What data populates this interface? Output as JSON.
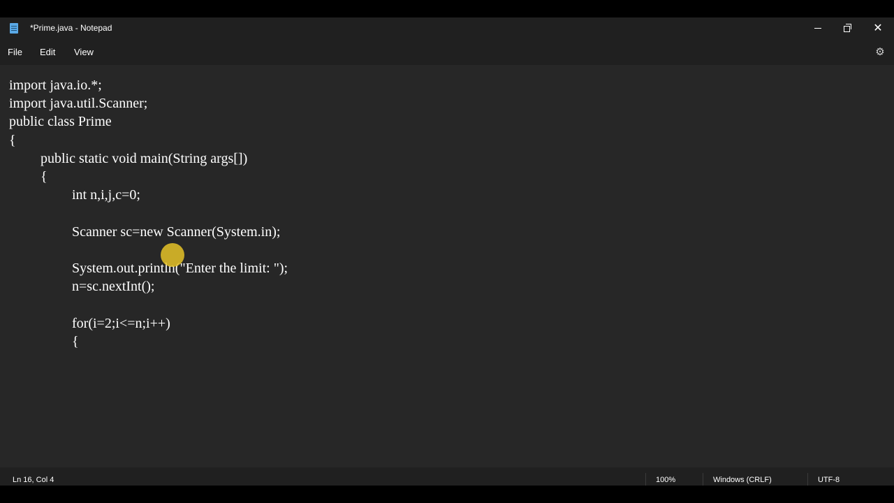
{
  "window": {
    "title": "*Prime.java - Notepad",
    "icon": "notepad-icon"
  },
  "menu": {
    "items": [
      "File",
      "Edit",
      "View"
    ],
    "settings_icon": "gear-icon"
  },
  "editor": {
    "lines": [
      "import java.io.*;",
      "import java.util.Scanner;",
      "public class Prime",
      "{",
      "\tpublic static void main(String args[])",
      "\t{",
      "\t\tint n,i,j,c=0;",
      "",
      "\t\tScanner sc=new Scanner(System.in);",
      "",
      "\t\tSystem.out.println(\"Enter the limit: \");",
      "\t\tn=sc.nextInt();",
      "",
      "\t\tfor(i=2;i<=n;i++)",
      "\t\t{"
    ]
  },
  "status": {
    "position": "Ln 16, Col 4",
    "zoom": "100%",
    "line_ending": "Windows (CRLF)",
    "encoding": "UTF-8"
  },
  "colors": {
    "background": "#272727",
    "chrome": "#202020",
    "text": "#ffffff",
    "cursor_highlight": "#e6c328"
  }
}
